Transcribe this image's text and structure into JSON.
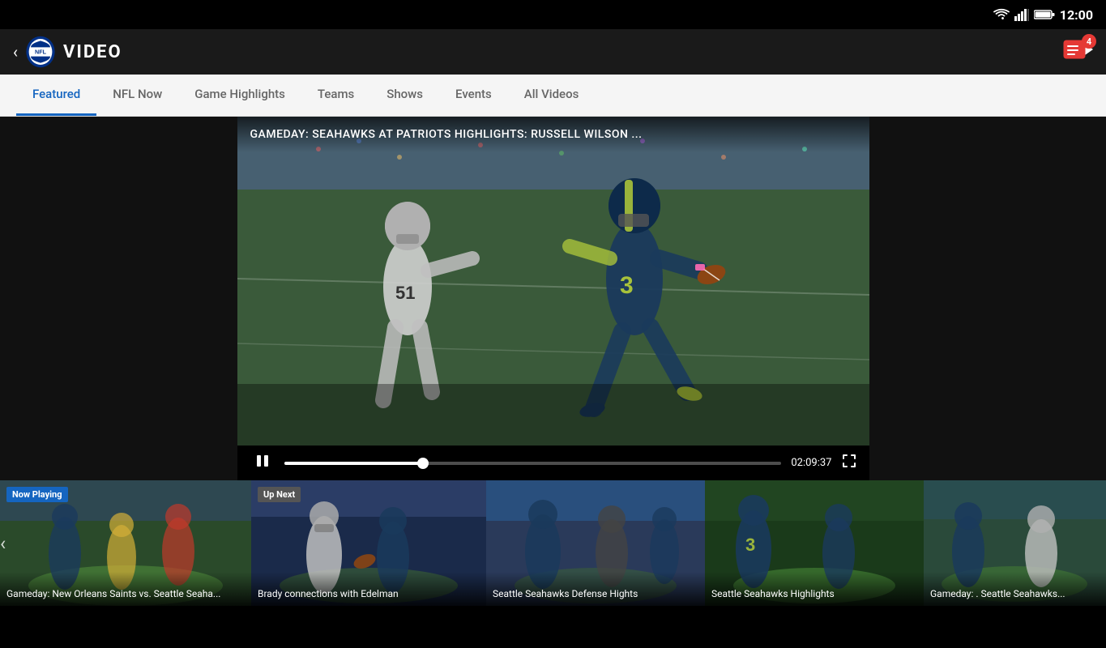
{
  "statusBar": {
    "time": "12:00",
    "batteryLevel": "full"
  },
  "header": {
    "title": "VIDEO",
    "backLabel": "‹",
    "badgeCount": "4"
  },
  "nav": {
    "tabs": [
      {
        "id": "featured",
        "label": "Featured",
        "active": true
      },
      {
        "id": "nfl-now",
        "label": "NFL Now",
        "active": false
      },
      {
        "id": "game-highlights",
        "label": "Game Highlights",
        "active": false
      },
      {
        "id": "teams",
        "label": "Teams",
        "active": false
      },
      {
        "id": "shows",
        "label": "Shows",
        "active": false
      },
      {
        "id": "events",
        "label": "Events",
        "active": false
      },
      {
        "id": "all-videos",
        "label": "All Videos",
        "active": false
      }
    ]
  },
  "videoPlayer": {
    "title": "GAMEDAY: SEAHAWKS AT PATRIOTS HIGHLIGHTS: RUSSELL WILSON ...",
    "duration": "02:09:37",
    "progressPercent": 28
  },
  "thumbnails": [
    {
      "badge": "Now Playing",
      "title": "Gameday: New Orleans Saints vs. Seattle Seaha...",
      "colorClass": "thumb-gradient"
    },
    {
      "badge": "Up Next",
      "title": "Brady connections with Edelman",
      "colorClass": "thumb-gradient-2"
    },
    {
      "badge": "",
      "title": "Seattle Seahawks Defense Hights",
      "colorClass": "thumb-gradient-3"
    },
    {
      "badge": "",
      "title": "Seattle Seahawks Highlights",
      "colorClass": "thumb-gradient-4"
    },
    {
      "badge": "",
      "title": "Gameday: . Seattle Seahawks...",
      "colorClass": "thumb-gradient-5"
    }
  ]
}
